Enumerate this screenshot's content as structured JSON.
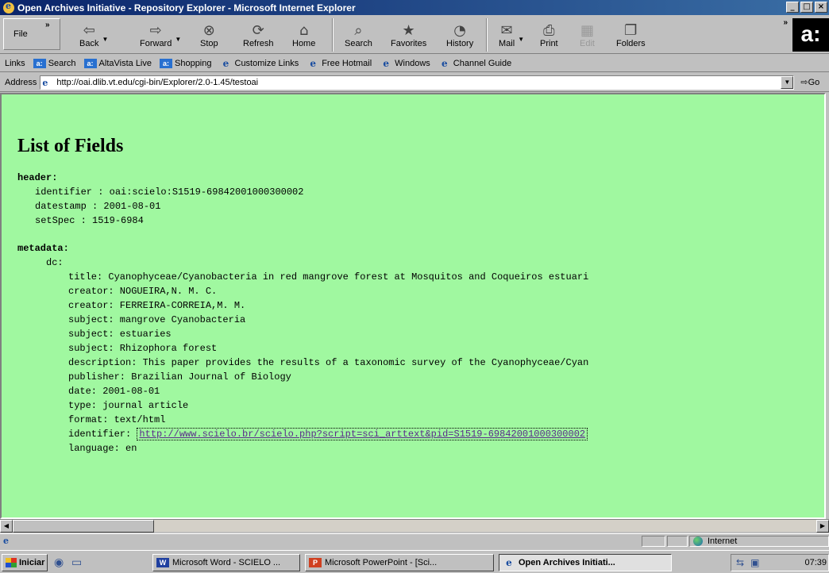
{
  "window": {
    "title": "Open Archives Initiative - Repository Explorer - Microsoft Internet Explorer",
    "min_glyph": "_",
    "max_glyph": "□",
    "close_glyph": "×"
  },
  "toolbar": {
    "file": "File",
    "more": "»",
    "buttons": {
      "back": "Back",
      "forward": "Forward",
      "stop": "Stop",
      "refresh": "Refresh",
      "home": "Home",
      "search": "Search",
      "favorites": "Favorites",
      "history": "History",
      "mail": "Mail",
      "print": "Print",
      "edit": "Edit",
      "folders": "Folders"
    },
    "brand": "a:"
  },
  "links_bar": {
    "label": "Links",
    "items": [
      "Search",
      "AltaVista Live",
      "Shopping",
      "Customize Links",
      "Free Hotmail",
      "Windows",
      "Channel Guide"
    ]
  },
  "address_bar": {
    "label": "Address",
    "url": "http://oai.dlib.vt.edu/cgi-bin/Explorer/2.0-1.45/testoai",
    "go": "Go"
  },
  "page": {
    "heading": "List of Fields",
    "header_label": "header:",
    "header_fields": [
      "identifier : oai:scielo:S1519-69842001000300002",
      "datestamp : 2001-08-01",
      "setSpec : 1519-6984"
    ],
    "metadata_label": "metadata:",
    "dc_label": "dc:",
    "dc_fields": [
      "title: Cyanophyceae/Cyanobacteria in red mangrove forest at Mosquitos and Coqueiros estuari",
      "creator: NOGUEIRA,N. M. C.",
      "creator: FERREIRA-CORREIA,M. M.",
      "subject: mangrove Cyanobacteria",
      "subject: estuaries",
      "subject: Rhizophora forest",
      "description: This paper provides the results of a taxonomic survey of the Cyanophyceae/Cyan",
      "publisher: Brazilian Journal of Biology",
      "date: 2001-08-01",
      "type: journal article",
      "format: text/html"
    ],
    "identifier_label": "identifier:",
    "identifier_link": "http://www.scielo.br/scielo.php?script=sci_arttext&pid=S1519-69842001000300002",
    "language": "language: en"
  },
  "status_bar": {
    "zone": "Internet"
  },
  "taskbar": {
    "start": "Iniciar",
    "tasks": [
      "Microsoft Word - SCIELO ...",
      "Microsoft PowerPoint - [Sci...",
      "Open Archives Initiati..."
    ],
    "clock": "07:39"
  }
}
